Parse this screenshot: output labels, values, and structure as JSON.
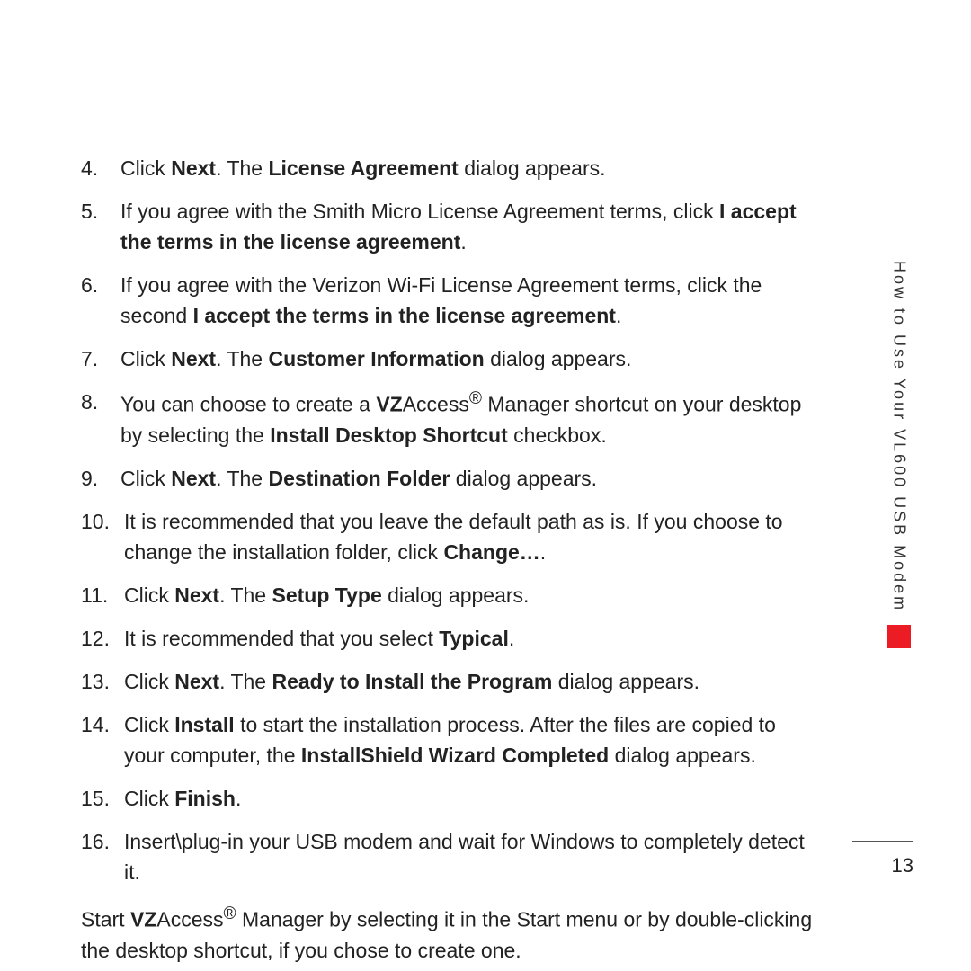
{
  "section_tab": "How to Use Your VL600 USB Modem",
  "page_number": "13",
  "steps": [
    {
      "n": "4.",
      "html": "Click <b>Next</b>. The <b>License Agreement</b> dialog appears."
    },
    {
      "n": "5.",
      "html": "If you agree with the Smith Micro License Agreement terms, click <b>I accept the terms in the license agreement</b>."
    },
    {
      "n": "6.",
      "html": "If you agree with the Verizon Wi-Fi License Agreement terms, click the second <b>I accept the terms in the license agreement</b>."
    },
    {
      "n": "7.",
      "html": "Click <b>Next</b>. The <b>Customer Information</b> dialog appears."
    },
    {
      "n": "8.",
      "html": "You can choose to create a <b>VZ</b>Access<sup>®</sup> Manager shortcut on your desktop by selecting the <b>Install Desktop Shortcut</b> checkbox."
    },
    {
      "n": "9.",
      "html": "Click <b>Next</b>. The <b>Destination Folder</b> dialog appears."
    },
    {
      "n": "10.",
      "html": "It is recommended that you leave the default path as is. If you choose to change the installation folder, click <b>Change…</b>."
    },
    {
      "n": "11.",
      "html": "Click <b>Next</b>. The <b>Setup Type</b> dialog appears."
    },
    {
      "n": "12.",
      "html": "It is recommended that you select <b>Typical</b>."
    },
    {
      "n": "13.",
      "html": "Click <b>Next</b>. The <b>Ready to Install the Program</b> dialog appears."
    },
    {
      "n": "14.",
      "html": "Click <b>Install</b> to start the installation process. After the files are copied to your computer, the <b>InstallShield Wizard Completed</b> dialog appears."
    },
    {
      "n": "15.",
      "html": "Click <b>Finish</b>."
    },
    {
      "n": "16.",
      "html": "Insert\\plug-in your USB modem and wait for Windows to completely detect it."
    }
  ],
  "after_html": "Start <b>VZ</b>Access<sup>®</sup> Manager by selecting it in the Start menu or by double-clicking the desktop shortcut, if you chose to create one."
}
